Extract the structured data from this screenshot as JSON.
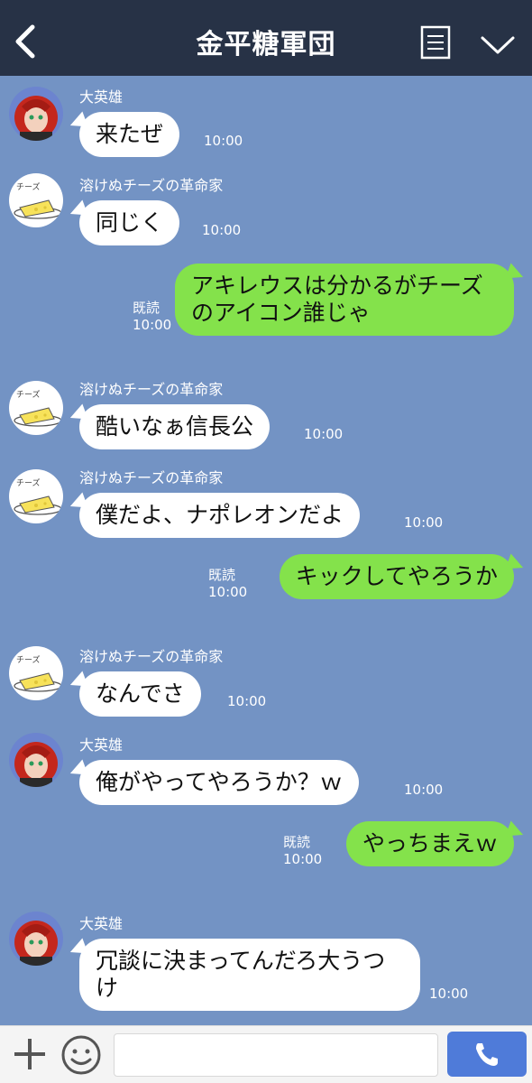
{
  "header": {
    "title": "金平糖軍団"
  },
  "chat": [
    {
      "sender": "大英雄",
      "text": "来たぜ",
      "time": "10:00"
    },
    {
      "sender": "溶けぬチーズの革命家",
      "text": "同じく",
      "time": "10:00"
    },
    {
      "text": "アキレウスは分かるがチーズのアイコン誰じゃ",
      "read": "既読",
      "time": "10:00"
    },
    {
      "sender": "溶けぬチーズの革命家",
      "text": "酷いなぁ信長公",
      "time": "10:00"
    },
    {
      "sender": "溶けぬチーズの革命家",
      "text": "僕だよ、ナポレオンだよ",
      "time": "10:00"
    },
    {
      "text": "キックしてやろうか",
      "read": "既読",
      "time": "10:00"
    },
    {
      "sender": "溶けぬチーズの革命家",
      "text": "なんでさ",
      "time": "10:00"
    },
    {
      "sender": "大英雄",
      "text": "俺がやってやろうか？ｗ",
      "time": "10:00"
    },
    {
      "text": "やっちまえｗ",
      "read": "既読",
      "time": "10:00"
    },
    {
      "sender": "大英雄",
      "text": "冗談に決まってんだろ大うつけ",
      "time": "10:00"
    }
  ],
  "avatar_cheese_label": "チーズ",
  "colors": {
    "background": "#7393c4",
    "header": "#273246",
    "outgoing": "#84e24b",
    "incoming": "#ffffff",
    "send": "#4f7bd9"
  },
  "icons": {
    "back": "chevron-left-icon",
    "notes": "notes-icon",
    "collapse": "chevron-down-icon",
    "plus": "plus-icon",
    "emoji": "smile-icon",
    "call": "phone-icon"
  }
}
